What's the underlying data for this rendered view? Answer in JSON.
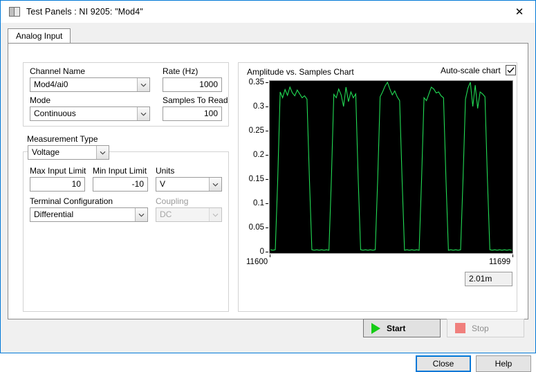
{
  "window": {
    "title": "Test Panels : NI 9205: \"Mod4\"",
    "icon": "window-icon",
    "close_icon": "close-icon"
  },
  "tabs": [
    {
      "label": "Analog Input",
      "selected": true
    }
  ],
  "channel_group": {
    "channel_name_label": "Channel Name",
    "channel_name_value": "Mod4/ai0",
    "rate_label": "Rate (Hz)",
    "rate_value": "1000",
    "mode_label": "Mode",
    "mode_value": "Continuous",
    "samples_label": "Samples To Read",
    "samples_value": "100"
  },
  "measurement_group": {
    "measurement_type_label": "Measurement Type",
    "measurement_type_value": "Voltage",
    "max_input_label": "Max Input Limit",
    "max_input_value": "10",
    "min_input_label": "Min Input Limit",
    "min_input_value": "-10",
    "units_label": "Units",
    "units_value": "V",
    "terminal_config_label": "Terminal Configuration",
    "terminal_config_value": "Differential",
    "coupling_label": "Coupling",
    "coupling_value": "DC",
    "coupling_disabled": true
  },
  "chart_panel": {
    "title": "Amplitude vs. Samples Chart",
    "autoscale_label": "Auto-scale chart",
    "autoscale_checked": true,
    "readout_value": "2.01m"
  },
  "chart_data": {
    "type": "line",
    "title": "Amplitude vs. Samples Chart",
    "xlabel": "",
    "ylabel": "",
    "grid": false,
    "legend": false,
    "plot_background": "#000000",
    "trace_color": "#22dd55",
    "xlim": [
      11600,
      11699
    ],
    "ylim": [
      0,
      0.35
    ],
    "xticks": [
      11600,
      11699
    ],
    "yticks": [
      0,
      0.05,
      0.1,
      0.15,
      0.2,
      0.25,
      0.3,
      0.35
    ],
    "series": [
      {
        "name": "Mod4/ai0",
        "x": [
          11600,
          11601,
          11602,
          11603,
          11604,
          11605,
          11606,
          11607,
          11608,
          11609,
          11610,
          11611,
          11612,
          11613,
          11614,
          11615,
          11616,
          11617,
          11618,
          11619,
          11620,
          11621,
          11622,
          11623,
          11624,
          11625,
          11626,
          11627,
          11628,
          11629,
          11630,
          11631,
          11632,
          11633,
          11634,
          11635,
          11636,
          11637,
          11638,
          11639,
          11640,
          11641,
          11642,
          11643,
          11644,
          11645,
          11646,
          11647,
          11648,
          11649,
          11650,
          11651,
          11652,
          11653,
          11654,
          11655,
          11656,
          11657,
          11658,
          11659,
          11660,
          11661,
          11662,
          11663,
          11664,
          11665,
          11666,
          11667,
          11668,
          11669,
          11670,
          11671,
          11672,
          11673,
          11674,
          11675,
          11676,
          11677,
          11678,
          11679,
          11680,
          11681,
          11682,
          11683,
          11684,
          11685,
          11686,
          11687,
          11688,
          11689,
          11690,
          11691,
          11692,
          11693,
          11694,
          11695,
          11696,
          11697,
          11698,
          11699
        ],
        "y": [
          0.004,
          0.003,
          0.004,
          0.15,
          0.33,
          0.318,
          0.335,
          0.323,
          0.34,
          0.328,
          0.322,
          0.334,
          0.326,
          0.318,
          0.322,
          0.315,
          0.15,
          0.004,
          0.003,
          0.004,
          0.003,
          0.004,
          0.003,
          0.004,
          0.003,
          0.15,
          0.325,
          0.318,
          0.336,
          0.324,
          0.3,
          0.34,
          0.31,
          0.33,
          0.318,
          0.326,
          0.15,
          0.004,
          0.003,
          0.004,
          0.003,
          0.004,
          0.003,
          0.004,
          0.15,
          0.32,
          0.33,
          0.342,
          0.35,
          0.336,
          0.324,
          0.332,
          0.32,
          0.312,
          0.15,
          0.003,
          0.004,
          0.003,
          0.004,
          0.003,
          0.004,
          0.003,
          0.15,
          0.318,
          0.312,
          0.326,
          0.34,
          0.336,
          0.328,
          0.33,
          0.322,
          0.318,
          0.15,
          0.003,
          0.004,
          0.003,
          0.004,
          0.003,
          0.004,
          0.15,
          0.315,
          0.338,
          0.35,
          0.3,
          0.344,
          0.296,
          0.33,
          0.326,
          0.32,
          0.15,
          0.004,
          0.003,
          0.004,
          0.003,
          0.004,
          0.003,
          0.004,
          0.003,
          0.004,
          0.003
        ]
      }
    ]
  },
  "actions": {
    "start_label": "Start",
    "start_icon": "play-icon",
    "stop_label": "Stop",
    "stop_icon": "stop-icon",
    "stop_disabled": true,
    "close_label": "Close",
    "help_label": "Help"
  }
}
